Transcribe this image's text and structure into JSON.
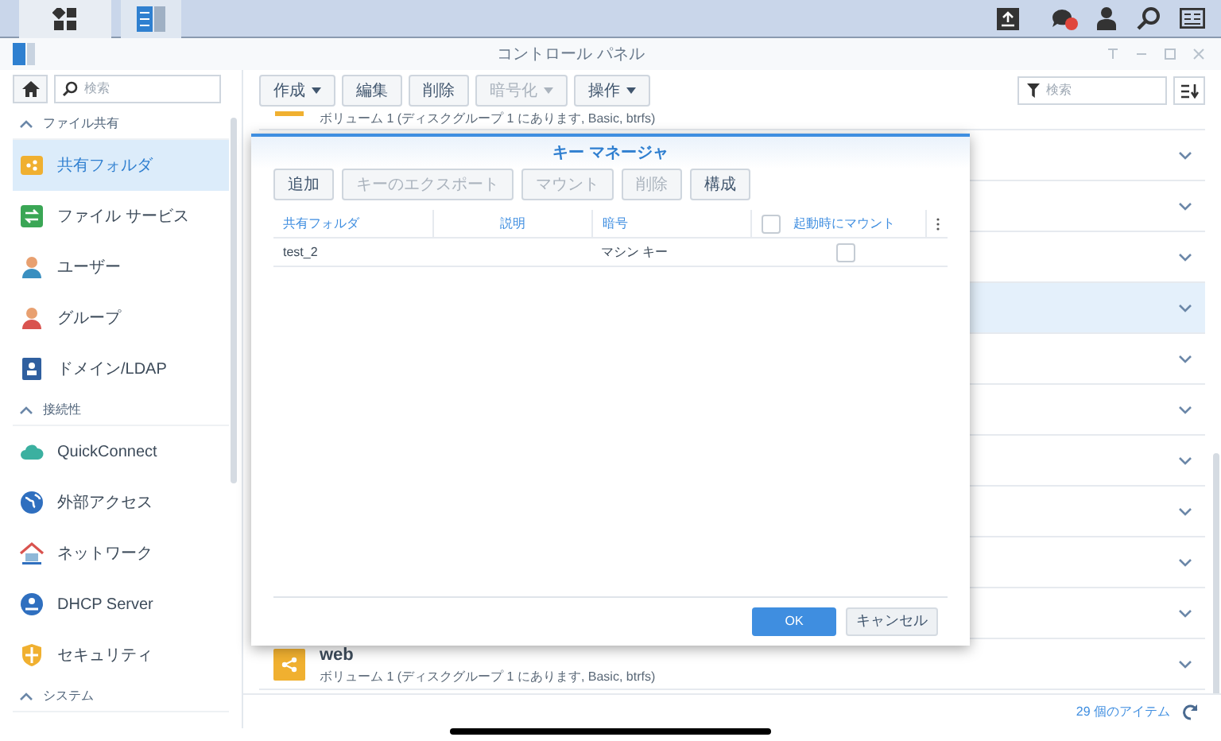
{
  "window": {
    "title": "コントロール パネル"
  },
  "sidebar": {
    "search": {
      "placeholder": "検索"
    },
    "sections": [
      {
        "title": "ファイル共有",
        "expanded": true,
        "items": [
          {
            "label": "共有フォルダ",
            "selected": true
          },
          {
            "label": "ファイル サービス",
            "selected": false
          },
          {
            "label": "ユーザー",
            "selected": false
          },
          {
            "label": "グループ",
            "selected": false
          },
          {
            "label": "ドメイン/LDAP",
            "selected": false
          }
        ]
      },
      {
        "title": "接続性",
        "expanded": true,
        "items": [
          {
            "label": "QuickConnect",
            "selected": false
          },
          {
            "label": "外部アクセス",
            "selected": false
          },
          {
            "label": "ネットワーク",
            "selected": false
          },
          {
            "label": "DHCP Server",
            "selected": false
          },
          {
            "label": "セキュリティ",
            "selected": false
          }
        ]
      },
      {
        "title": "システム",
        "expanded": true
      }
    ]
  },
  "toolbar": {
    "buttons": [
      {
        "label": "作成",
        "dropdown": true,
        "disabled": false
      },
      {
        "label": "編集",
        "dropdown": false,
        "disabled": false
      },
      {
        "label": "削除",
        "dropdown": false,
        "disabled": false
      },
      {
        "label": "暗号化",
        "dropdown": true,
        "disabled": true
      },
      {
        "label": "操作",
        "dropdown": true,
        "disabled": false
      }
    ],
    "search": {
      "placeholder": "検索"
    }
  },
  "list": {
    "rows": [
      {
        "partial": true,
        "subtitle": "ボリューム 1 (ディスクグループ 1 にあります, Basic, btrfs)",
        "selected": false
      },
      {
        "selected": false
      },
      {
        "selected": false
      },
      {
        "selected": false
      },
      {
        "selected": true
      },
      {
        "selected": false
      },
      {
        "selected": false
      },
      {
        "selected": false
      },
      {
        "selected": false
      },
      {
        "selected": false
      },
      {
        "selected": false
      },
      {
        "name": "web",
        "subtitle": "ボリューム 1 (ディスクグループ 1 にあります, Basic, btrfs)",
        "selected": false
      }
    ],
    "status": "29 個のアイテム"
  },
  "dialog": {
    "title": "キー マネージャ",
    "buttons": [
      {
        "label": "追加",
        "disabled": false
      },
      {
        "label": "キーのエクスポート",
        "disabled": true
      },
      {
        "label": "マウント",
        "disabled": true
      },
      {
        "label": "削除",
        "disabled": true
      },
      {
        "label": "構成",
        "disabled": false
      }
    ],
    "columns": [
      {
        "label": "共有フォルダ"
      },
      {
        "label": "説明"
      },
      {
        "label": "暗号"
      },
      {
        "label": "起動時にマウント",
        "checked": false
      }
    ],
    "rows": [
      {
        "shared_folder": "test_2",
        "encryption": "マシン キー",
        "mount_on_boot": false
      }
    ],
    "ok": "OK",
    "cancel": "キャンセル"
  }
}
